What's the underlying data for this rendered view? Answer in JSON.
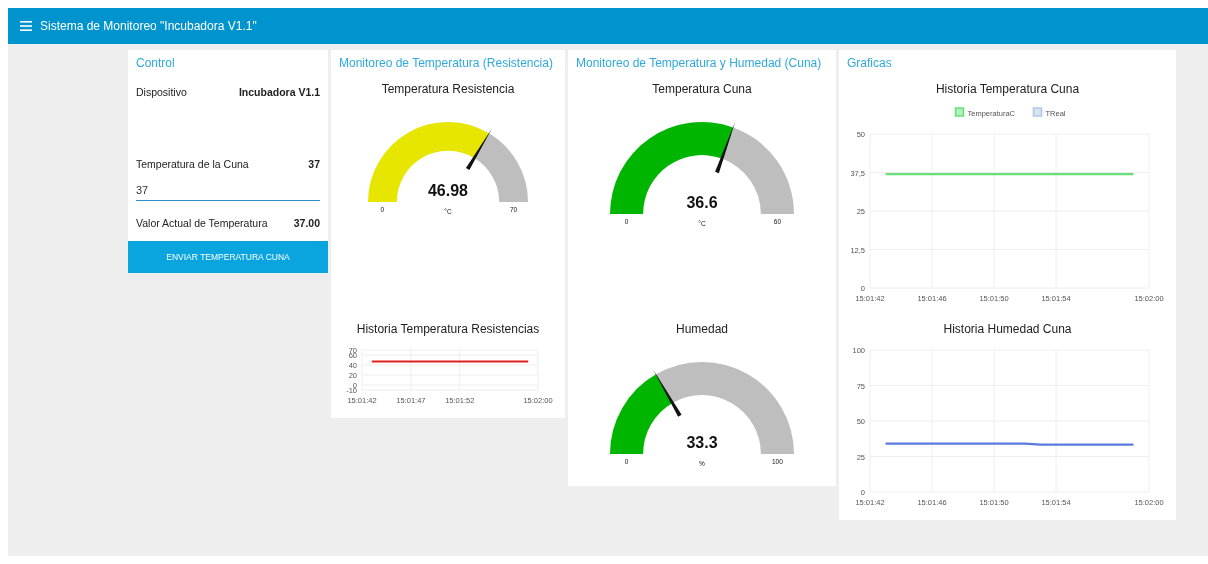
{
  "header": {
    "title": "Sistema de Monitoreo \"Incubadora V1.1\""
  },
  "groups": [
    {
      "title": "Control",
      "widgets": [
        {
          "kind": "info",
          "label": "Dispositivo",
          "value": "Incubadora V1.1"
        },
        {
          "kind": "info",
          "label": "Temperatura de la Cuna",
          "value": "37"
        },
        {
          "kind": "input",
          "value": "37"
        },
        {
          "kind": "info",
          "label": "Valor Actual de Temperatura",
          "value": "37.00"
        },
        {
          "kind": "button",
          "label": "ENVIAR TEMPERATURA CUNA"
        }
      ]
    },
    {
      "title": "Monitoreo de Temperatura (Resistencia)",
      "widgets": [
        {
          "kind": "gauge",
          "title": "Temperatura Resistencia",
          "value": "46.98",
          "unit": "°C",
          "min": "0",
          "max": "70",
          "color": "#e6e600"
        },
        {
          "kind": "chart",
          "chart_data": {
            "type": "line",
            "title": "Historia Temperatura Resistencias",
            "grid": true,
            "ylim": [
              -10,
              70
            ],
            "yticks": [
              -10,
              0,
              20,
              40,
              60,
              70
            ],
            "categories": [
              "15:01:42",
              null,
              null,
              null,
              null,
              "15:01:47",
              null,
              null,
              null,
              null,
              "15:01:52",
              null,
              null,
              null,
              null,
              null,
              null,
              null,
              "15:02:00"
            ],
            "series": [
              {
                "color": "#e02020",
                "values": [
                  null,
                  47,
                  47,
                  47,
                  47,
                  47,
                  47,
                  47,
                  47,
                  47,
                  47,
                  47,
                  47,
                  47,
                  47,
                  47,
                  47,
                  47,
                  null
                ]
              }
            ]
          }
        }
      ]
    },
    {
      "title": "Monitoreo de Temperatura y Humedad (Cuna)",
      "widgets": [
        {
          "kind": "gauge",
          "title": "Temperatura Cuna",
          "value": "36.6",
          "unit": "°C",
          "min": "0",
          "max": "60",
          "color": "#00b500"
        },
        {
          "kind": "gauge",
          "title": "Humedad",
          "value": "33.3",
          "unit": "%",
          "min": "0",
          "max": "100",
          "color": "#00b500"
        }
      ]
    },
    {
      "title": "Graficas",
      "widgets": [
        {
          "kind": "chart",
          "chart_data": {
            "type": "line",
            "title": "Historia Temperatura Cuna",
            "grid": true,
            "ylim": [
              0,
              50
            ],
            "yticks": [
              0,
              {
                "value": 12.5,
                "label": "12,5"
              },
              25,
              {
                "value": 37.5,
                "label": "37,5"
              },
              50
            ],
            "categories": [
              "15:01:42",
              null,
              null,
              null,
              "15:01:46",
              null,
              null,
              null,
              "15:01:50",
              null,
              null,
              null,
              "15:01:54",
              null,
              null,
              null,
              null,
              null,
              "15:02:00"
            ],
            "series": [
              {
                "name": "TemperaturaC",
                "color": "#66e07a",
                "values": [
                  null,
                  37,
                  37,
                  37,
                  37,
                  37,
                  37,
                  37,
                  37,
                  37,
                  37,
                  37,
                  37,
                  37,
                  37,
                  37,
                  37,
                  37,
                  null
                ]
              },
              {
                "name": "TReal",
                "color": "#aec7e8",
                "values": [
                  null,
                  null,
                  null,
                  null,
                  null,
                  null,
                  null,
                  null,
                  null,
                  null,
                  null,
                  null,
                  null,
                  null,
                  null,
                  null,
                  null,
                  null,
                  null
                ]
              }
            ]
          }
        },
        {
          "kind": "chart",
          "chart_data": {
            "type": "line",
            "title": "Historia Humedad Cuna",
            "grid": true,
            "ylim": [
              0,
              100
            ],
            "yticks": [
              0,
              25,
              50,
              75,
              100
            ],
            "categories": [
              "15:01:42",
              null,
              null,
              null,
              "15:01:46",
              null,
              null,
              null,
              "15:01:50",
              null,
              null,
              null,
              "15:01:54",
              null,
              null,
              null,
              null,
              null,
              "15:02:00"
            ],
            "series": [
              {
                "color": "#5b7be0",
                "values": [
                  null,
                  34,
                  34,
                  34,
                  34,
                  34,
                  34,
                  34,
                  34,
                  34,
                  34,
                  33.3,
                  33.3,
                  33.3,
                  33.3,
                  33.3,
                  33.3,
                  33.3,
                  null
                ]
              }
            ]
          }
        }
      ]
    }
  ]
}
